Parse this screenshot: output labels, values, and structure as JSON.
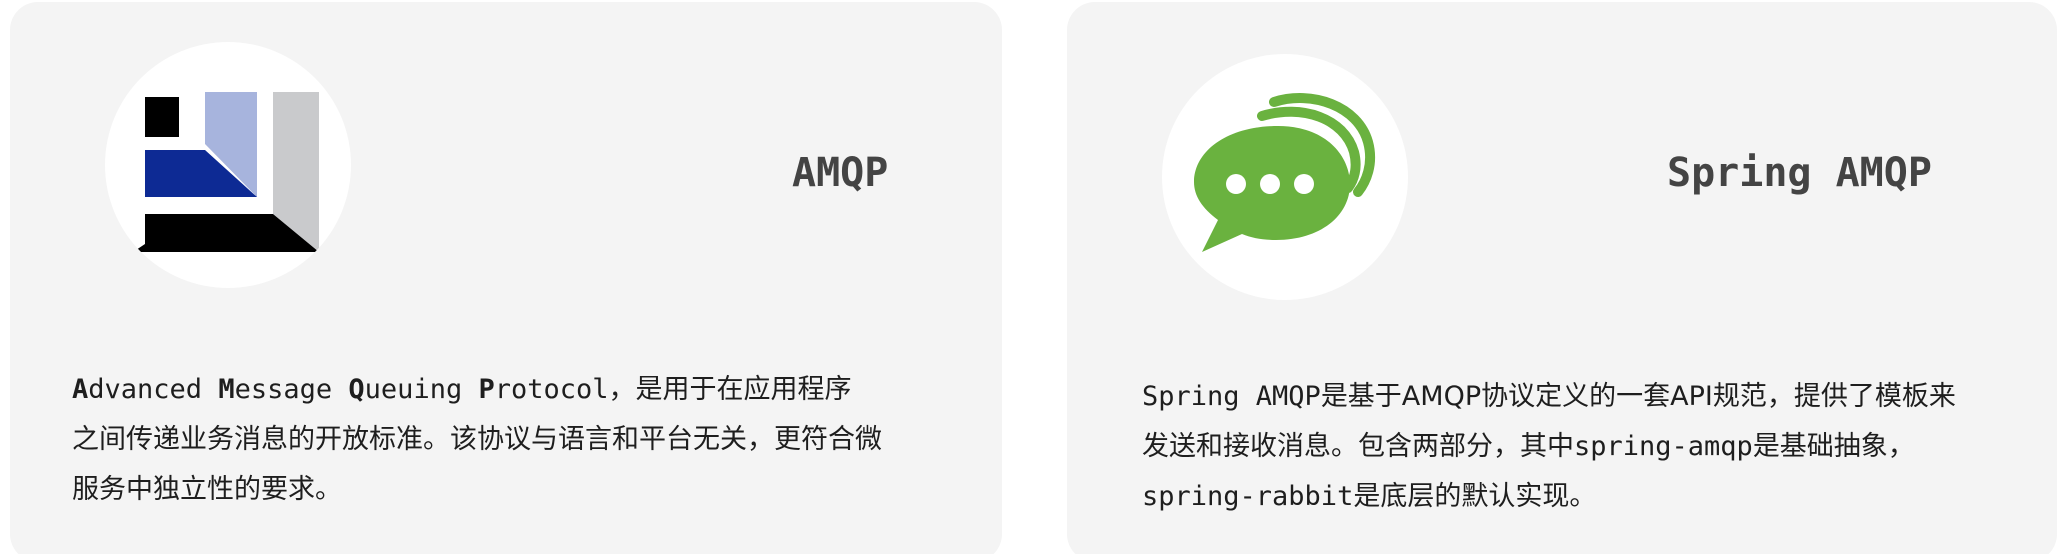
{
  "amqp_card": {
    "title": "AMQP",
    "logo_icon": "amqp-logo-icon",
    "desc": {
      "acronym_words": [
        {
          "initial": "A",
          "rest": "dvanced"
        },
        {
          "initial": "M",
          "rest": "essage"
        },
        {
          "initial": "Q",
          "rest": "ueuing"
        },
        {
          "initial": "P",
          "rest": "rotocol"
        }
      ],
      "line1_tail": "，是用于在应用程序",
      "line2": "之间传递业务消息的开放标准。该协议与语言和平台无关，更符合微",
      "line3": "服务中独立性的要求。"
    },
    "colors": {
      "navy": "#0d2a94",
      "light_blue": "#a7b4dd",
      "grey": "#c9cacc",
      "black": "#000000"
    }
  },
  "spring_amqp_card": {
    "title": "Spring AMQP",
    "logo_icon": "chat-bubble-icon",
    "desc": {
      "line1_code": "Spring AMQP",
      "line1_text": "是基于AMQP协议定义的一套API规范，提供了模板来",
      "line2_text": "发送和接收消息。包含两部分，其中",
      "line2_code": "spring-amqp",
      "line2_tail": "是基础抽象，",
      "line3_code": "spring-rabbit",
      "line3_text": "是底层的默认实现。"
    },
    "colors": {
      "green": "#6ab23f",
      "white": "#ffffff"
    }
  }
}
